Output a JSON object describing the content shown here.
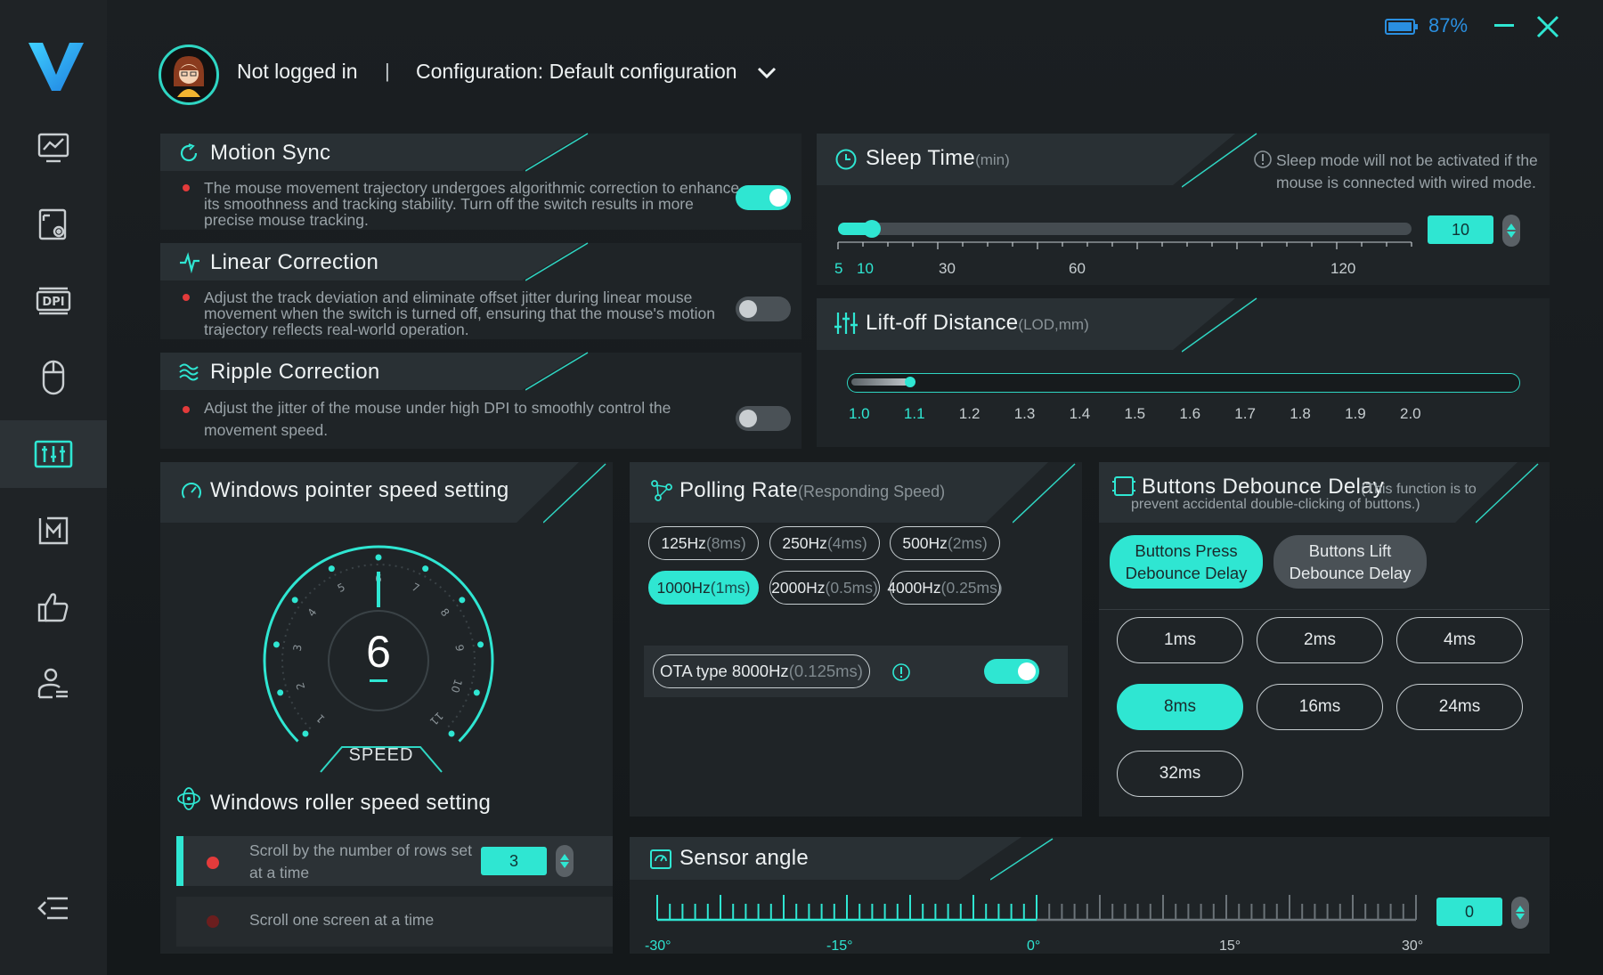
{
  "battery": {
    "percent": "87%"
  },
  "header": {
    "user": "Not logged in",
    "separator": "|",
    "config": "Configuration: Default configuration"
  },
  "motion_sync": {
    "title": "Motion Sync",
    "desc": "The mouse movement trajectory undergoes algorithmic correction to enhance its smoothness and tracking stability. Turn off the switch results in more precise mouse tracking.",
    "enabled": true
  },
  "linear_correction": {
    "title": "Linear Correction",
    "desc": "Adjust the track deviation and eliminate offset jitter during linear mouse movement when the switch is turned off, ensuring that the mouse's motion trajectory reflects real-world operation.",
    "enabled": false
  },
  "ripple_correction": {
    "title": "Ripple Correction",
    "desc": "Adjust the jitter of the mouse under high DPI to smoothly control the movement speed.",
    "enabled": false
  },
  "sleep_time": {
    "title": "Sleep Time",
    "unit": "(min)",
    "note": "Sleep mode will not be activated if the mouse is connected with wired mode.",
    "value": "10",
    "ticks": [
      "5",
      "10",
      "30",
      "60",
      "120"
    ],
    "level": 0.043
  },
  "lod": {
    "title": "Lift-off Distance",
    "unit": "(LOD,mm)",
    "ticks": [
      "1.0",
      "1.1",
      "1.2",
      "1.3",
      "1.4",
      "1.5",
      "1.6",
      "1.7",
      "1.8",
      "1.9",
      "2.0"
    ],
    "selected": "1.1"
  },
  "pointer": {
    "title": "Windows pointer speed setting",
    "value": "6",
    "label": "SPEED",
    "dial": [
      "1",
      "2",
      "3",
      "4",
      "5",
      "6",
      "7",
      "8",
      "9",
      "10",
      "11"
    ]
  },
  "roller": {
    "title": "Windows roller speed setting",
    "opt1": "Scroll by the number of rows set at a time",
    "opt1_value": "3",
    "opt2": "Scroll one screen at a time"
  },
  "polling": {
    "title": "Polling Rate",
    "sub": "(Responding Speed)",
    "options": [
      {
        "hz": "125Hz",
        "ms": "(8ms)"
      },
      {
        "hz": "250Hz",
        "ms": "(4ms)"
      },
      {
        "hz": "500Hz",
        "ms": "(2ms)"
      },
      {
        "hz": "1000Hz",
        "ms": "(1ms)"
      },
      {
        "hz": "2000Hz",
        "ms": "(0.5ms)"
      },
      {
        "hz": "4000Hz",
        "ms": "(0.25ms)"
      }
    ],
    "selected": "1000Hz",
    "ota": {
      "hz": "OTA type 8000Hz",
      "ms": "(0.125ms)",
      "enabled": true
    }
  },
  "debounce": {
    "title": "Buttons Debounce Delay",
    "sub": "(This function is to prevent accidental double-clicking of buttons.)",
    "tab1": "Buttons Press Debounce Delay",
    "tab2": "Buttons Lift Debounce Delay",
    "options": [
      "1ms",
      "2ms",
      "4ms",
      "8ms",
      "16ms",
      "24ms",
      "32ms"
    ],
    "selected": "8ms"
  },
  "sensor": {
    "title": "Sensor angle",
    "value": "0",
    "ticks": [
      "-30°",
      "-15°",
      "0°",
      "15°",
      "30°"
    ]
  },
  "colors": {
    "accent": "#2fe6d2",
    "panel": "#1f2427",
    "danger": "#e33b3b"
  }
}
